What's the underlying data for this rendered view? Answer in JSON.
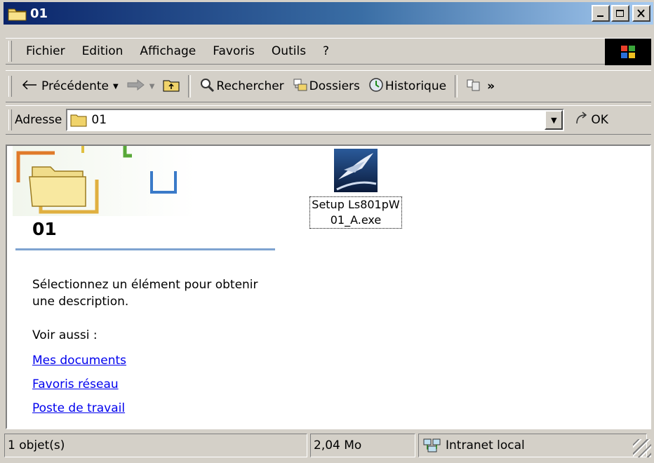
{
  "window": {
    "title": "01"
  },
  "menu": [
    "Fichier",
    "Edition",
    "Affichage",
    "Favoris",
    "Outils",
    "?"
  ],
  "toolbar": {
    "back_label": "Précédente",
    "search_label": "Rechercher",
    "folders_label": "Dossiers",
    "history_label": "Historique",
    "more_label": "»"
  },
  "address": {
    "label": "Adresse",
    "value": "01",
    "go_label": "OK"
  },
  "panel": {
    "title": "01",
    "description": "Sélectionnez un élément pour obtenir une description.",
    "see_also_label": "Voir aussi :",
    "links": [
      "Mes documents",
      "Favoris réseau",
      "Poste de travail"
    ]
  },
  "files": [
    {
      "name_line1": "Setup Ls801pW",
      "name_line2": "01_A.exe",
      "icon": "installer-icon"
    }
  ],
  "status": {
    "objects": "1 objet(s)",
    "size": "2,04 Mo",
    "zone": "Intranet local"
  },
  "colors": {
    "title_start": "#0a246a",
    "title_end": "#a6caf0",
    "link": "#0000ee",
    "panel_line": "#7ea3d0"
  }
}
